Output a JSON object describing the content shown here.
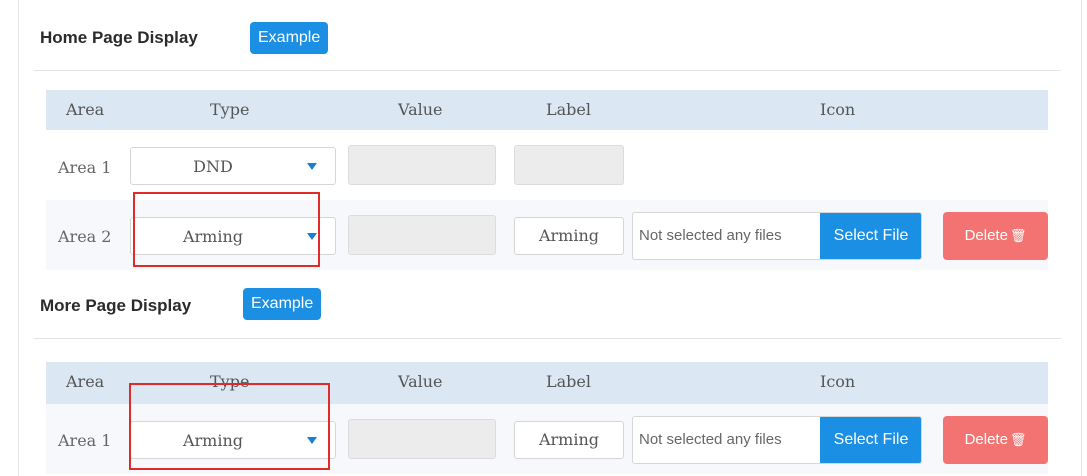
{
  "home": {
    "title": "Home Page Display",
    "example_label": "Example",
    "headers": {
      "area": "Area",
      "type": "Type",
      "value": "Value",
      "label": "Label",
      "icon": "Icon"
    },
    "rows": [
      {
        "area": "Area 1",
        "type": "DND",
        "label_value": ""
      },
      {
        "area": "Area 2",
        "type": "Arming",
        "label_value": "Arming",
        "file_text": "Not selected any files",
        "select_file": "Select File",
        "delete": "Delete"
      }
    ]
  },
  "more": {
    "title": "More Page Display",
    "example_label": "Example",
    "headers": {
      "area": "Area",
      "type": "Type",
      "value": "Value",
      "label": "Label",
      "icon": "Icon"
    },
    "rows": [
      {
        "area": "Area 1",
        "type": "Arming",
        "label_value": "Arming",
        "file_text": "Not selected any files",
        "select_file": "Select File",
        "delete": "Delete"
      }
    ]
  },
  "colors": {
    "primary": "#1a8fe3",
    "danger": "#f37373",
    "highlight": "#e02b2b",
    "header_bg": "#dbe7f3"
  },
  "icons": {
    "caret": "caret-down-icon",
    "trash": "trash-icon"
  }
}
